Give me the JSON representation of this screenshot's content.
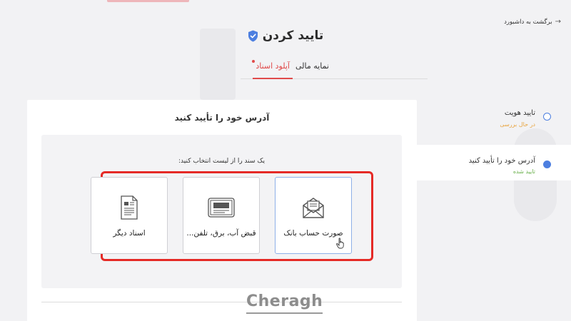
{
  "header": {
    "back_link": "برگشت به داشبورد",
    "title": "تایید کردن"
  },
  "tabs": [
    {
      "label": "آپلود اسناد",
      "active": true
    },
    {
      "label": "نمایه مالی",
      "active": false
    }
  ],
  "panel": {
    "title": "آدرس خود را تأیید کنید",
    "prompt": "یک سند را از لیست انتخاب کنید:",
    "options": [
      {
        "label": "صورت حساب بانک",
        "icon": "envelope-document-icon",
        "selected": true
      },
      {
        "label": "قبض آب، برق، تلفن...",
        "icon": "bill-receipt-icon",
        "selected": false
      },
      {
        "label": "اسناد دیگر",
        "icon": "document-icon",
        "selected": false
      }
    ]
  },
  "steps": [
    {
      "title": "تایید هویت",
      "status": "در حال بررسی"
    },
    {
      "title": "آدرس خود را تأیید کنید",
      "status": "تایید شده"
    }
  ],
  "watermark": "Cheragh",
  "colors": {
    "accent_red": "#e04a4a",
    "highlight_red": "#e52a26",
    "primary_blue": "#4d7fe0",
    "pending_orange": "#e8a33c",
    "approved_green": "#6ab04c"
  }
}
